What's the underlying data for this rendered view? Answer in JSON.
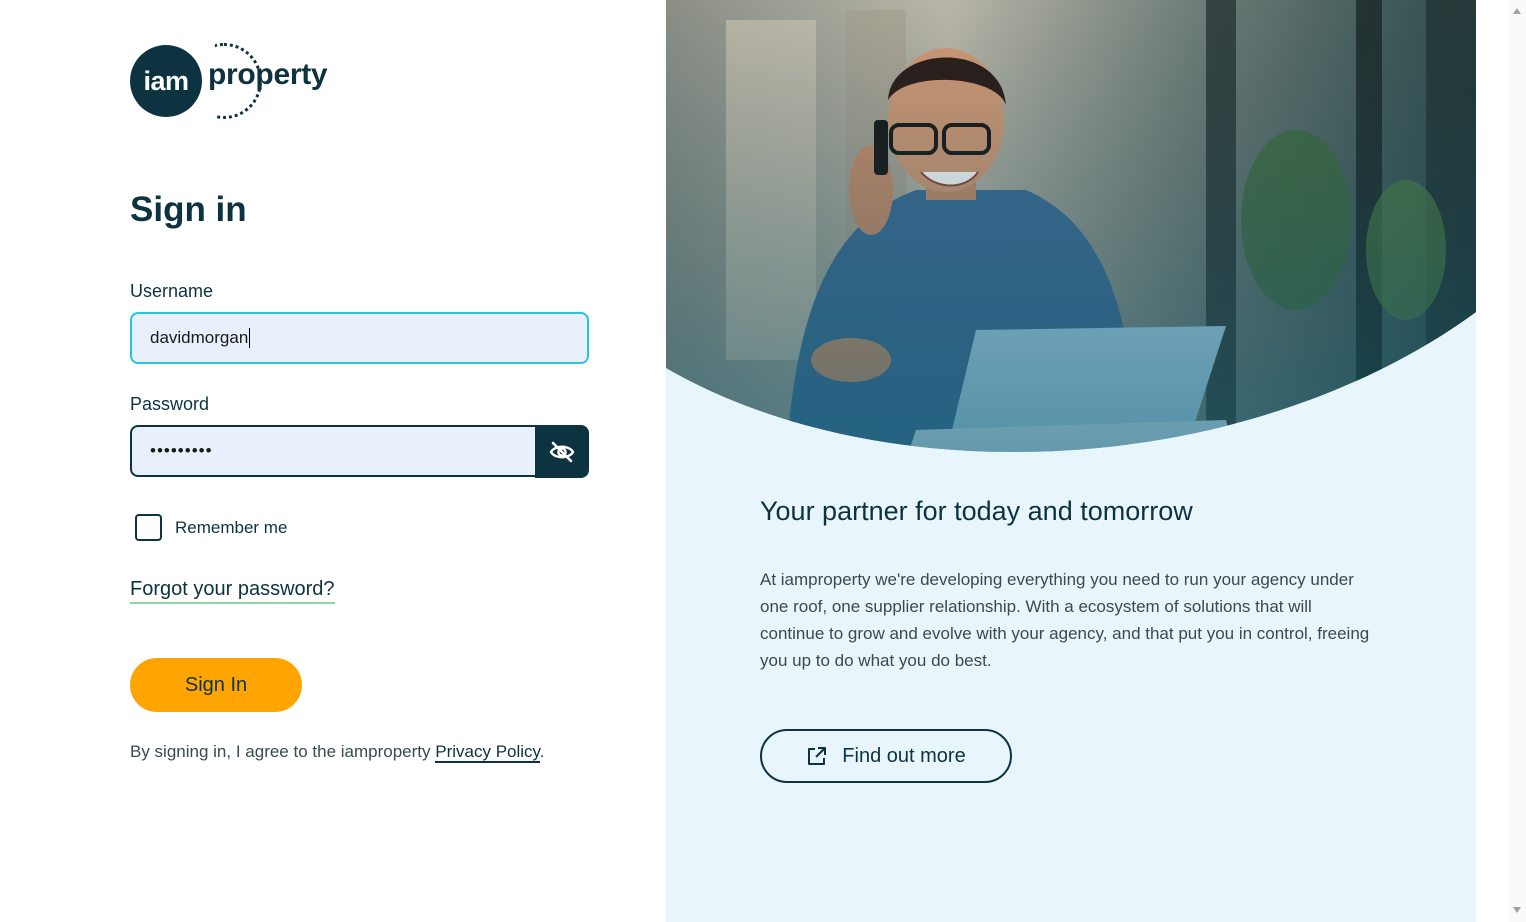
{
  "brand": {
    "logo_mark": "iam",
    "logo_word": "property"
  },
  "signin": {
    "title": "Sign in",
    "username_label": "Username",
    "username_value": "davidmorgan",
    "password_label": "Password",
    "password_value": "•••••••••",
    "remember_label": "Remember me",
    "remember_checked": false,
    "forgot_link": "Forgot your password?",
    "submit_label": "Sign In",
    "agree_prefix": "By signing in, I agree to the iamproperty ",
    "agree_link": "Privacy Policy",
    "agree_suffix": "."
  },
  "promo": {
    "heading": "Your partner for today and tomorrow",
    "body": "At iamproperty we're developing everything you need to run your agency under one roof, one supplier relationship. With a ecosystem of solutions that will continue to grow and evolve with your agency, and that put you in control, freeing you up to do what you do best.",
    "cta_label": "Find out more",
    "cta_icon": "external-link-icon"
  },
  "colors": {
    "brand_dark": "#0d3340",
    "accent_orange": "#ffa400",
    "focus_cyan": "#29c3df",
    "panel_bg": "#e8f6fb",
    "link_underline": "#8fd6a5"
  }
}
